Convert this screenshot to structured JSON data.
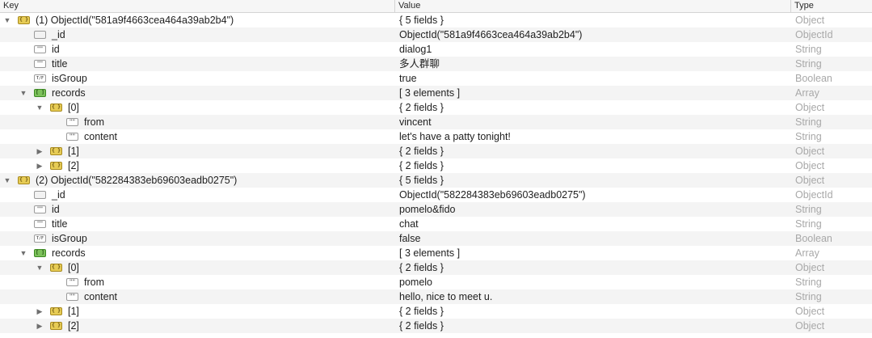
{
  "columns": {
    "key": "Key",
    "value": "Value",
    "type": "Type"
  },
  "icon_glyphs": {
    "object": "{ }",
    "array": "[ ]",
    "string": "\"\"",
    "boolean": "T/F",
    "objectid": ""
  },
  "rows": [
    {
      "key": "(1) ObjectId(\"581a9f4663cea464a39ab2b4\")",
      "value": "{ 5 fields }",
      "type": "Object",
      "icon": "object",
      "depth": 0,
      "toggle": "expanded"
    },
    {
      "key": "_id",
      "value": "ObjectId(\"581a9f4663cea464a39ab2b4\")",
      "type": "ObjectId",
      "icon": "objectid",
      "depth": 1,
      "toggle": "none"
    },
    {
      "key": "id",
      "value": "dialog1",
      "type": "String",
      "icon": "string",
      "depth": 1,
      "toggle": "none"
    },
    {
      "key": "title",
      "value": "多人群聊",
      "type": "String",
      "icon": "string",
      "depth": 1,
      "toggle": "none"
    },
    {
      "key": "isGroup",
      "value": "true",
      "type": "Boolean",
      "icon": "boolean",
      "depth": 1,
      "toggle": "none"
    },
    {
      "key": "records",
      "value": "[ 3 elements ]",
      "type": "Array",
      "icon": "array",
      "depth": 1,
      "toggle": "expanded"
    },
    {
      "key": "[0]",
      "value": "{ 2 fields }",
      "type": "Object",
      "icon": "object",
      "depth": 2,
      "toggle": "expanded"
    },
    {
      "key": "from",
      "value": "vincent",
      "type": "String",
      "icon": "string",
      "depth": 3,
      "toggle": "none"
    },
    {
      "key": "content",
      "value": "let's have a patty tonight!",
      "type": "String",
      "icon": "string",
      "depth": 3,
      "toggle": "none"
    },
    {
      "key": "[1]",
      "value": "{ 2 fields }",
      "type": "Object",
      "icon": "object",
      "depth": 2,
      "toggle": "collapsed"
    },
    {
      "key": "[2]",
      "value": "{ 2 fields }",
      "type": "Object",
      "icon": "object",
      "depth": 2,
      "toggle": "collapsed"
    },
    {
      "key": "(2) ObjectId(\"582284383eb69603eadb0275\")",
      "value": "{ 5 fields }",
      "type": "Object",
      "icon": "object",
      "depth": 0,
      "toggle": "expanded"
    },
    {
      "key": "_id",
      "value": "ObjectId(\"582284383eb69603eadb0275\")",
      "type": "ObjectId",
      "icon": "objectid",
      "depth": 1,
      "toggle": "none"
    },
    {
      "key": "id",
      "value": "pomelo&fido",
      "type": "String",
      "icon": "string",
      "depth": 1,
      "toggle": "none"
    },
    {
      "key": "title",
      "value": "chat",
      "type": "String",
      "icon": "string",
      "depth": 1,
      "toggle": "none"
    },
    {
      "key": "isGroup",
      "value": "false",
      "type": "Boolean",
      "icon": "boolean",
      "depth": 1,
      "toggle": "none"
    },
    {
      "key": "records",
      "value": "[ 3 elements ]",
      "type": "Array",
      "icon": "array",
      "depth": 1,
      "toggle": "expanded"
    },
    {
      "key": "[0]",
      "value": "{ 2 fields }",
      "type": "Object",
      "icon": "object",
      "depth": 2,
      "toggle": "expanded"
    },
    {
      "key": "from",
      "value": "pomelo",
      "type": "String",
      "icon": "string",
      "depth": 3,
      "toggle": "none"
    },
    {
      "key": "content",
      "value": "hello, nice to meet u.",
      "type": "String",
      "icon": "string",
      "depth": 3,
      "toggle": "none"
    },
    {
      "key": "[1]",
      "value": "{ 2 fields }",
      "type": "Object",
      "icon": "object",
      "depth": 2,
      "toggle": "collapsed"
    },
    {
      "key": "[2]",
      "value": "{ 2 fields }",
      "type": "Object",
      "icon": "object",
      "depth": 2,
      "toggle": "collapsed"
    }
  ]
}
